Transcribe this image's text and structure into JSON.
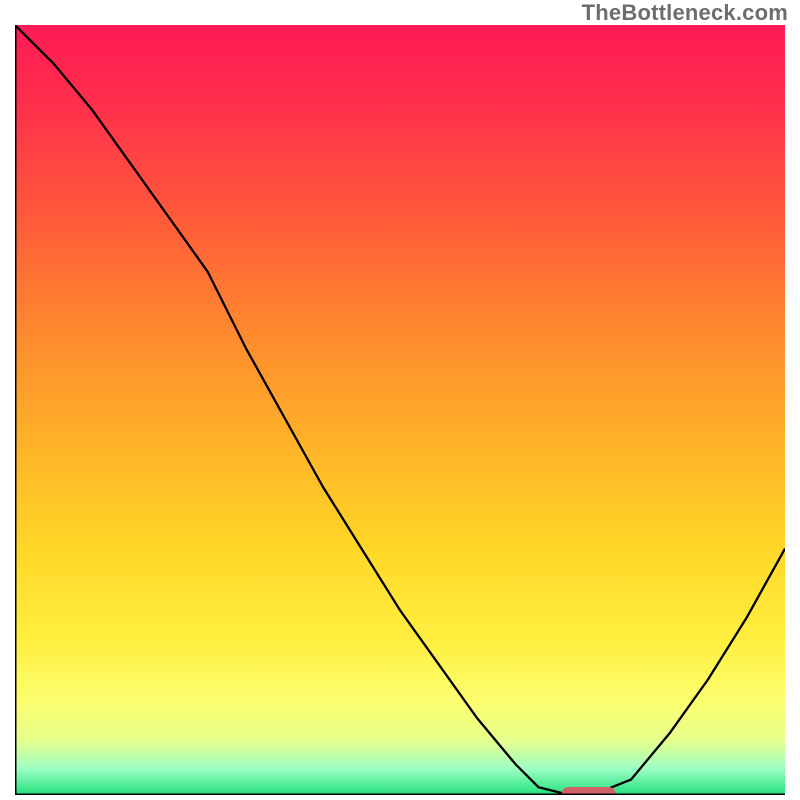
{
  "watermark": "TheBottleneck.com",
  "chart_data": {
    "type": "line",
    "title": "",
    "xlabel": "",
    "ylabel": "",
    "xlim": [
      0,
      100
    ],
    "ylim": [
      0,
      100
    ],
    "grid": false,
    "series": [
      {
        "name": "bottleneck-curve",
        "x": [
          0,
          5,
          10,
          15,
          20,
          25,
          30,
          35,
          40,
          45,
          50,
          55,
          60,
          65,
          68,
          72,
          75,
          80,
          85,
          90,
          95,
          100
        ],
        "y": [
          100,
          95,
          89,
          82,
          75,
          68,
          58,
          49,
          40,
          32,
          24,
          17,
          10,
          4,
          1,
          0,
          0,
          2,
          8,
          15,
          23,
          32
        ]
      }
    ],
    "marker": {
      "name": "optimal-range",
      "x_start": 71,
      "x_end": 78,
      "y": 0,
      "color": "#d35f6a"
    },
    "gradient_stops": [
      {
        "offset": 0.0,
        "color": "#ff1a55"
      },
      {
        "offset": 0.1,
        "color": "#ff2e4c"
      },
      {
        "offset": 0.25,
        "color": "#ff5a3a"
      },
      {
        "offset": 0.4,
        "color": "#ff8a2e"
      },
      {
        "offset": 0.55,
        "color": "#ffb428"
      },
      {
        "offset": 0.68,
        "color": "#ffd727"
      },
      {
        "offset": 0.8,
        "color": "#ffef3f"
      },
      {
        "offset": 0.88,
        "color": "#fcff70"
      },
      {
        "offset": 0.93,
        "color": "#e4ff8c"
      },
      {
        "offset": 0.965,
        "color": "#9effc3"
      },
      {
        "offset": 1.0,
        "color": "#24e07e"
      }
    ],
    "axis_color": "#000000",
    "curve_color": "#000000",
    "curve_width": 2.3
  }
}
